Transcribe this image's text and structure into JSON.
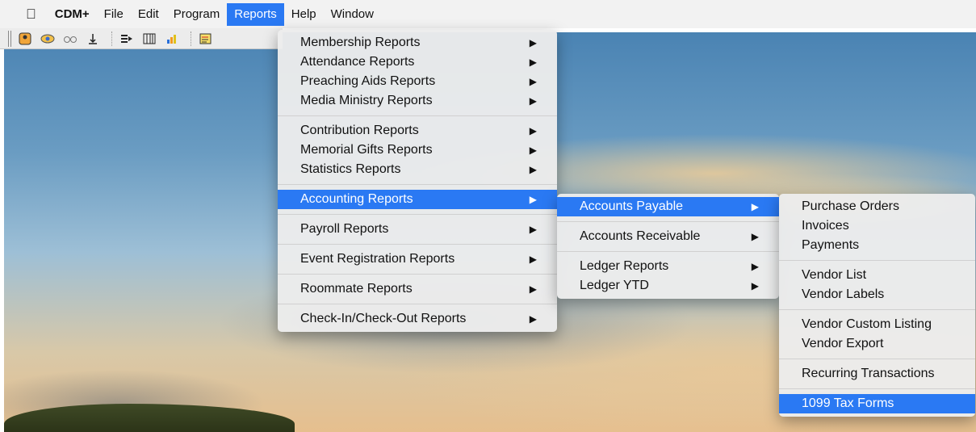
{
  "menubar": {
    "apple_icon": "apple-logo-icon",
    "items": [
      "CDM+",
      "File",
      "Edit",
      "Program",
      "Reports",
      "Help",
      "Window"
    ]
  },
  "toolbar": {
    "icons": [
      "person-card-icon",
      "eye-hand-icon",
      "glasses-icon",
      "download-icon",
      "list-arrow-icon",
      "columns-icon",
      "chart-icon",
      "notepad-icon"
    ]
  },
  "reports_menu": {
    "items": [
      "Membership Reports",
      "Attendance Reports",
      "Preaching Aids Reports",
      "Media Ministry Reports",
      "Contribution Reports",
      "Memorial Gifts Reports",
      "Statistics Reports",
      "Accounting Reports",
      "Payroll Reports",
      "Event Registration Reports",
      "Roommate Reports",
      "Check-In/Check-Out Reports"
    ]
  },
  "accounting_menu": {
    "items": [
      "Accounts Payable",
      "Accounts Receivable",
      "Ledger Reports",
      "Ledger YTD"
    ]
  },
  "payable_menu": {
    "items": [
      "Purchase Orders",
      "Invoices",
      "Payments",
      "Vendor List",
      "Vendor Labels",
      "Vendor Custom Listing",
      "Vendor Export",
      "Recurring Transactions",
      "1099 Tax Forms"
    ]
  },
  "colors": {
    "highlight": "#2a79f3",
    "menubar": "#f2f2f2"
  }
}
